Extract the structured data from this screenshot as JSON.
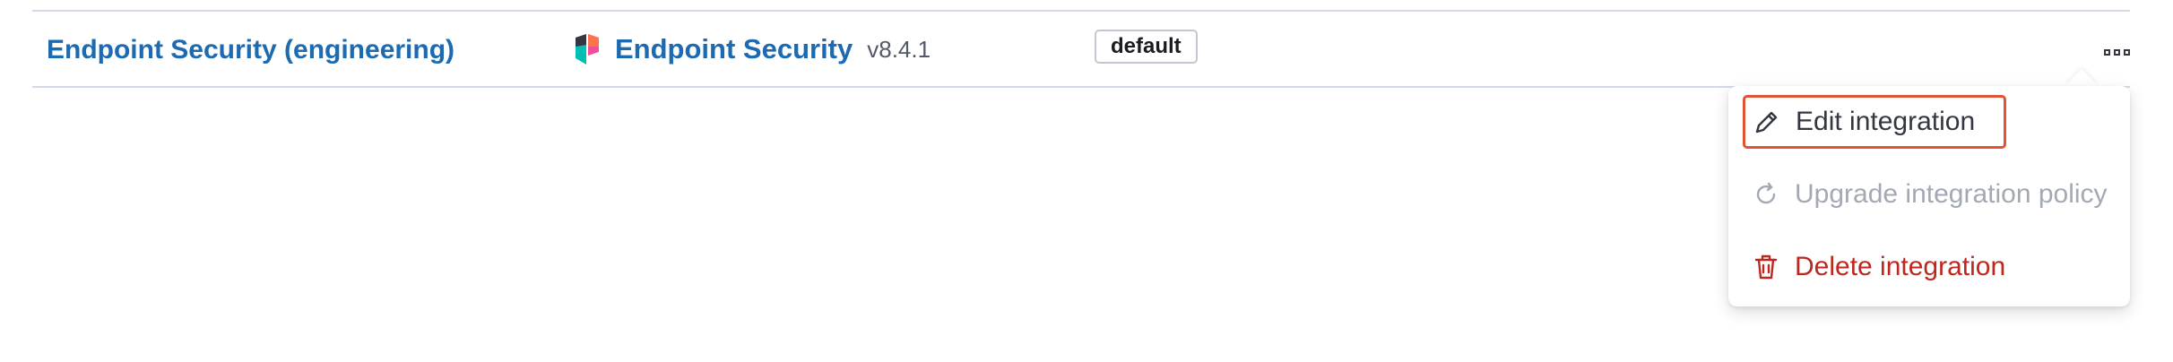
{
  "row": {
    "policy_name": "Endpoint Security (engineering)",
    "integration": {
      "logo": "elastic-security-logo",
      "name": "Endpoint Security",
      "version": "v8.4.1"
    },
    "namespace": "default",
    "actions_icon": "ellipsis-icon"
  },
  "actions_menu": {
    "items": [
      {
        "label": "Edit integration",
        "icon": "pencil-icon",
        "state": "focused"
      },
      {
        "label": "Upgrade integration policy",
        "icon": "refresh-icon",
        "state": "disabled"
      },
      {
        "label": "Delete integration",
        "icon": "trash-icon",
        "state": "danger"
      }
    ]
  },
  "colors": {
    "link": "#1b6ab2",
    "danger": "#bd271e",
    "disabled": "#a3a9b4",
    "focus_outline": "#e05434",
    "border": "#d3dae6"
  }
}
